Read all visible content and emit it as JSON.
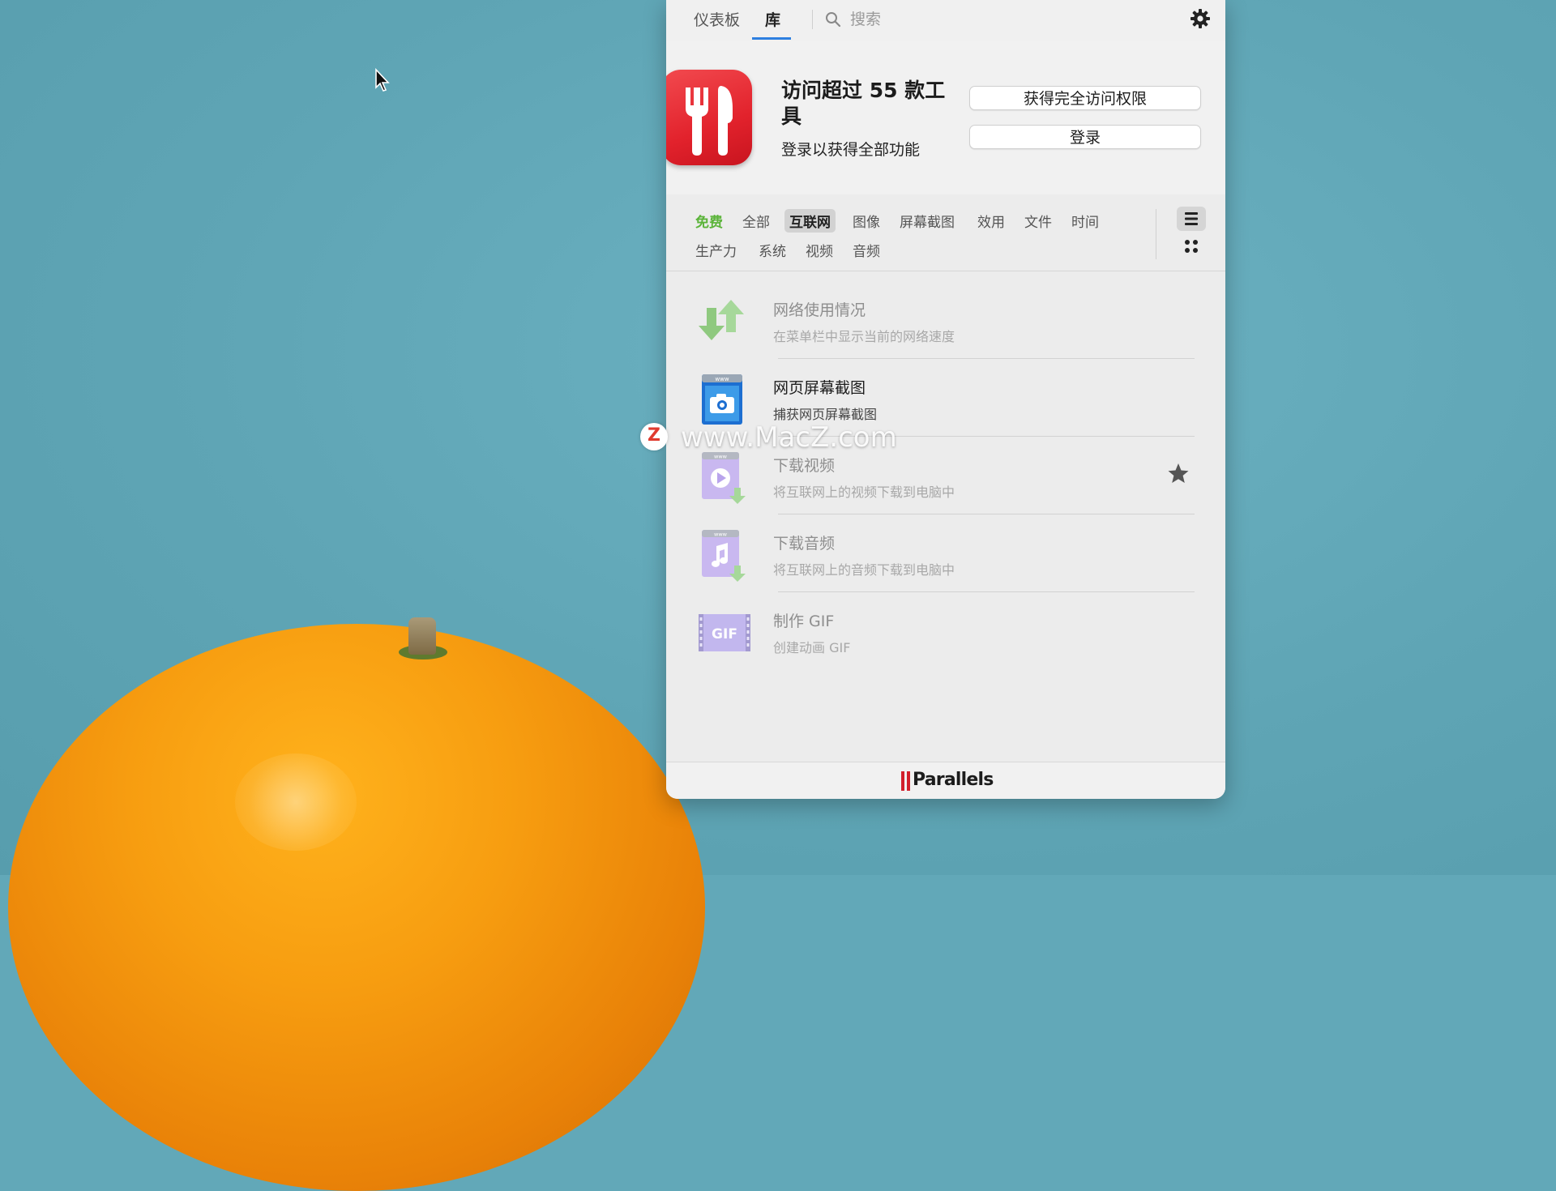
{
  "topbar": {
    "tabs": [
      {
        "label": "仪表板"
      },
      {
        "label": "库"
      }
    ],
    "search_placeholder": "搜索"
  },
  "hero": {
    "title": "访问超过 55 款工具",
    "subtitle": "登录以获得全部功能",
    "full_access_label": "获得完全访问权限",
    "login_label": "登录"
  },
  "categories": [
    {
      "label": "免费"
    },
    {
      "label": "全部"
    },
    {
      "label": "互联网"
    },
    {
      "label": "图像"
    },
    {
      "label": "屏幕截图"
    },
    {
      "label": "效用"
    },
    {
      "label": "文件"
    },
    {
      "label": "时间"
    },
    {
      "label": "生产力"
    },
    {
      "label": "系统"
    },
    {
      "label": "视频"
    },
    {
      "label": "音频"
    }
  ],
  "tools": [
    {
      "title": "网络使用情况",
      "desc": "在菜单栏中显示当前的网络速度",
      "icon": "network-arrows-icon"
    },
    {
      "title": "网页屏幕截图",
      "desc": "捕获网页屏幕截图",
      "icon": "web-screenshot-icon"
    },
    {
      "title": "下载视频",
      "desc": "将互联网上的视频下载到电脑中",
      "icon": "download-video-icon"
    },
    {
      "title": "下载音频",
      "desc": "将互联网上的音频下载到电脑中",
      "icon": "download-audio-icon"
    },
    {
      "title": "制作 GIF",
      "desc": "创建动画 GIF",
      "icon": "make-gif-icon"
    }
  ],
  "gif_icon_text": "GIF",
  "footer": {
    "brand": "Parallels"
  },
  "watermark": {
    "text": "www.MacZ.com",
    "badge": "Z"
  },
  "colors": {
    "accent": "#2d7fe0",
    "free_green": "#5bb43a",
    "brand_red": "#e2222c"
  }
}
